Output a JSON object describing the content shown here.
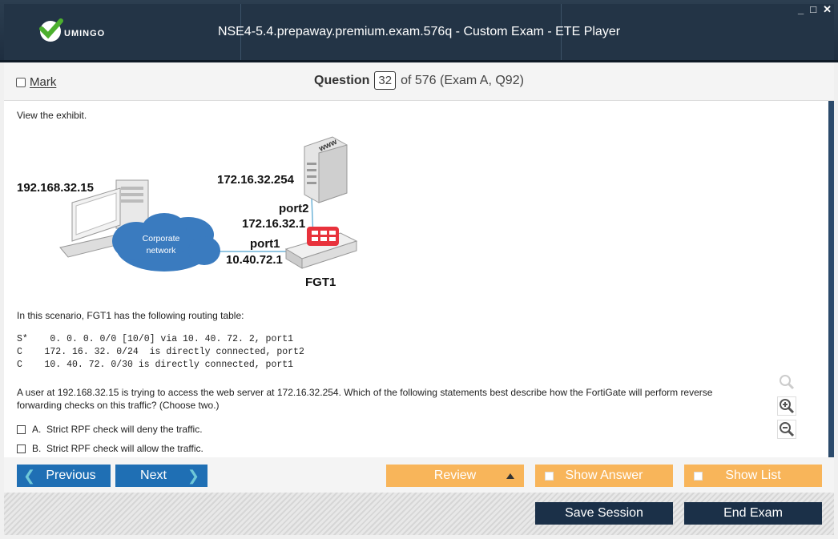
{
  "window": {
    "title": "NSE4-5.4.prepaway.premium.exam.576q - Custom Exam - ETE Player",
    "logo_text": "UMINGO",
    "controls": {
      "minimize": "_",
      "maximize": "□",
      "close": "✕"
    }
  },
  "question_header": {
    "mark_label": "Mark",
    "question_label": "Question",
    "question_number": "32",
    "of_text": "of 576 (Exam A, Q92)"
  },
  "content": {
    "intro": "View the exhibit.",
    "exhibit": {
      "client_ip": "192.168.32.15",
      "server_ip": "172.16.32.254",
      "server_label": "www",
      "port2_label": "port2",
      "port2_ip": "172.16.32.1",
      "port1_label": "port1",
      "port1_ip": "10.40.72.1",
      "fgt_label": "FGT1",
      "cloud_label_1": "Corporate",
      "cloud_label_2": "network"
    },
    "routing_intro": "In this scenario, FGT1 has the following routing table:",
    "routes": [
      "S*    0. 0. 0. 0/0 [10/0] via 10. 40. 72. 2, port1",
      "C    172. 16. 32. 0/24  is directly connected, port2",
      "C    10. 40. 72. 0/30 is directly connected, port1"
    ],
    "question_line1": "A user at 192.168.32.15 is trying to access the web server at 172.16.32.254. Which of the following statements best describe how the FortiGate will perform reverse",
    "question_line2": "forwarding checks on this traffic? (Choose two.)",
    "options": [
      {
        "letter": "A.",
        "text": "Strict RPF check will deny the traffic."
      },
      {
        "letter": "B.",
        "text": "Strict RPF check will allow the traffic."
      }
    ]
  },
  "nav": {
    "previous": "Previous",
    "next": "Next",
    "review": "Review",
    "show_answer": "Show Answer",
    "show_list": "Show List"
  },
  "footer": {
    "save_session": "Save Session",
    "end_exam": "End Exam"
  },
  "colors": {
    "nav_blue": "#1f6fb4",
    "orange": "#f8b55a",
    "dark": "#1b3048",
    "fortinet_red": "#e8323c"
  }
}
